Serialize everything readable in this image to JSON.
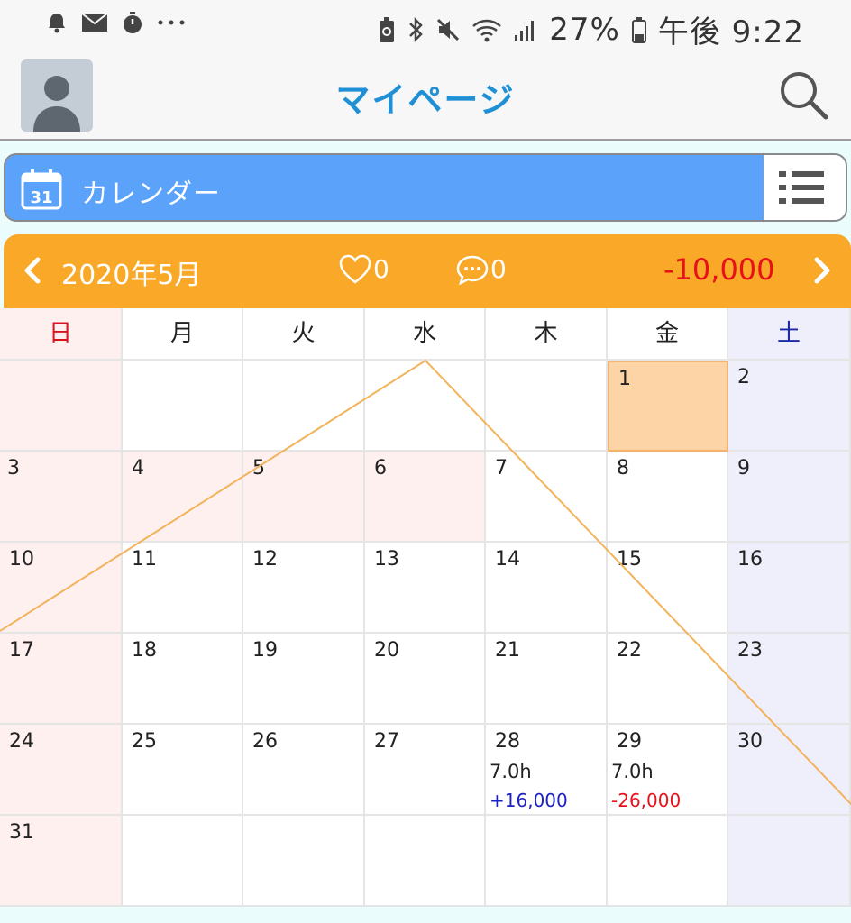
{
  "status_bar": {
    "battery": "27%",
    "time": "午後 9:22",
    "icons_left": [
      "bell-icon",
      "mail-icon",
      "timer-icon",
      "more-icon"
    ],
    "icons_right": [
      "battery-saver-icon",
      "bluetooth-icon",
      "mute-icon",
      "wifi-icon",
      "signal-icon",
      "battery-icon"
    ]
  },
  "header": {
    "title": "マイページ",
    "avatar_icon": "user-avatar-icon",
    "search_icon": "search-icon"
  },
  "calendar_bar": {
    "label": "カレンダー",
    "calendar_icon_text": "31"
  },
  "month_nav": {
    "month": "2020年5月",
    "likes": "0",
    "comments": "0",
    "amount": "-10,000"
  },
  "weekdays": [
    "日",
    "月",
    "火",
    "水",
    "木",
    "金",
    "土"
  ],
  "weeks": [
    [
      "",
      "",
      "",
      "",
      "",
      "1",
      "2"
    ],
    [
      "3",
      "4",
      "5",
      "6",
      "7",
      "8",
      "9"
    ],
    [
      "10",
      "11",
      "12",
      "13",
      "14",
      "15",
      "16"
    ],
    [
      "17",
      "18",
      "19",
      "20",
      "21",
      "22",
      "23"
    ],
    [
      "24",
      "25",
      "26",
      "27",
      "28",
      "29",
      "30"
    ],
    [
      "31",
      "",
      "",
      "",
      "",
      "",
      ""
    ]
  ],
  "entries": {
    "d28": {
      "hours": "7.0h",
      "amount": "+16,000"
    },
    "d29": {
      "hours": "7.0h",
      "amount": "-26,000"
    }
  },
  "colors": {
    "accent_blue": "#5aa2fa",
    "month_bar": "#f9a828",
    "title_blue": "#1f8fd6",
    "negative_red": "#e8101a",
    "positive_blue": "#1b22c4",
    "today": "#fdd4a6"
  }
}
